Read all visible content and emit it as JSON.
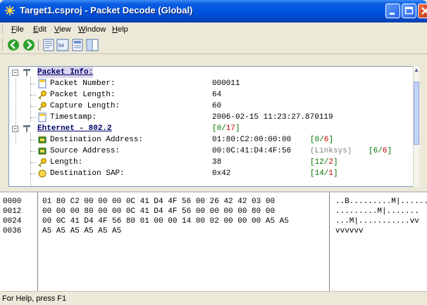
{
  "window": {
    "title": "Target1.csproj - Packet Decode (Global)"
  },
  "menu": [
    {
      "label": "File",
      "key": "F",
      "rest": "ile"
    },
    {
      "label": "Edit",
      "key": "E",
      "rest": "dit"
    },
    {
      "label": "View",
      "key": "V",
      "rest": "iew"
    },
    {
      "label": "Window",
      "key": "W",
      "rest": "indow"
    },
    {
      "label": "Help",
      "key": "H",
      "rest": "elp"
    }
  ],
  "toolbar": [
    "back-icon",
    "forward-icon",
    "decode-view-icon",
    "hex-view-icon",
    "text-view-icon",
    "split-view-icon"
  ],
  "tree": {
    "packet_info": {
      "label": "Packet Info:",
      "fields": [
        {
          "name": "Packet Number:",
          "value": "000011",
          "icon": "page"
        },
        {
          "name": "Packet Length:",
          "value": "64",
          "icon": "key"
        },
        {
          "name": "Capture Length:",
          "value": "60",
          "icon": "key"
        },
        {
          "name": "Timestamp:",
          "value": "2006-02-15 11:23:27.870119",
          "icon": "page"
        }
      ]
    },
    "ethernet": {
      "label": "Ehternet - 802.2",
      "range": {
        "a": "0",
        "b": "17"
      },
      "fields": [
        {
          "name": "Destination Address:",
          "value": "01:80:C2:00:00:00",
          "range": {
            "a": "0",
            "b": "6"
          },
          "icon": "chip"
        },
        {
          "name": "Source Address:",
          "value": "00:0C:41:D4:4F:56",
          "extra": "(Linksys)",
          "range": {
            "a": "6",
            "b": "6"
          },
          "icon": "chip"
        },
        {
          "name": "Length:",
          "value": "38",
          "range": {
            "a": "12",
            "b": "2"
          },
          "icon": "key"
        },
        {
          "name": "Destination SAP:",
          "value": "0x42",
          "range": {
            "a": "14",
            "b": "1"
          },
          "icon": "circle"
        }
      ]
    }
  },
  "hex": {
    "offsets": [
      "0000",
      "0012",
      "0024",
      "0036"
    ],
    "bytes": [
      "01 80 C2 00 00 00 0C 41 D4 4F 56 00 26 42 42 03 00",
      "00 00 00 80 00 00 0C 41 D4 4F 56 00 00 00 00 80 00",
      "00 0C 41 D4 4F 56 80 01 00 00 14 00 02 00 00 00 A5 A5",
      "A5 A5 A5 A5 A5 A5"
    ],
    "ascii": [
      "..B.........M|.......",
      ".........M|.......",
      "...M|...........vv",
      "vvvvvv"
    ]
  },
  "status": {
    "text": "For Help, press F1"
  }
}
